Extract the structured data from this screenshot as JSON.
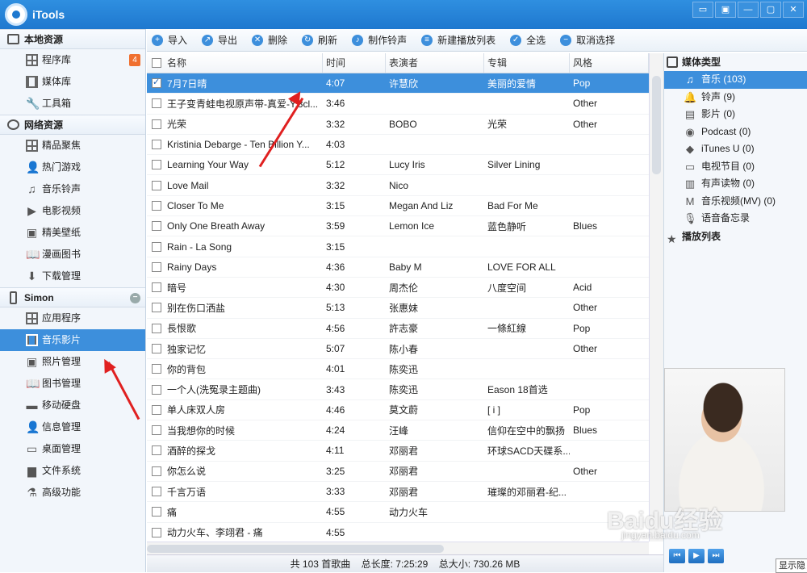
{
  "app": {
    "title": "iTools"
  },
  "window_buttons": [
    "▭",
    "▣",
    "—",
    "▢",
    "✕"
  ],
  "sidebar": {
    "sections": [
      {
        "title": "本地资源",
        "icon": "monitor-icon",
        "items": [
          {
            "label": "程序库",
            "icon": "grid-icon",
            "badge": "4"
          },
          {
            "label": "媒体库",
            "icon": "film-icon"
          },
          {
            "label": "工具箱",
            "icon": "wrench-icon"
          }
        ]
      },
      {
        "title": "网络资源",
        "icon": "globe-icon",
        "items": [
          {
            "label": "精品聚焦",
            "icon": "grid-icon"
          },
          {
            "label": "热门游戏",
            "icon": "person-icon"
          },
          {
            "label": "音乐铃声",
            "icon": "music-note-icon"
          },
          {
            "label": "电影视频",
            "icon": "video-icon"
          },
          {
            "label": "精美壁纸",
            "icon": "picture-icon"
          },
          {
            "label": "漫画图书",
            "icon": "book-icon"
          },
          {
            "label": "下载管理",
            "icon": "download-icon"
          }
        ]
      },
      {
        "title": "Simon",
        "icon": "phone-icon",
        "items": [
          {
            "label": "应用程序",
            "icon": "grid-icon"
          },
          {
            "label": "音乐影片",
            "icon": "film-icon",
            "active": true
          },
          {
            "label": "照片管理",
            "icon": "picture-icon"
          },
          {
            "label": "图书管理",
            "icon": "book-icon"
          },
          {
            "label": "移动硬盘",
            "icon": "usb-drive-icon"
          },
          {
            "label": "信息管理",
            "icon": "contact-icon"
          },
          {
            "label": "桌面管理",
            "icon": "desktop-icon"
          },
          {
            "label": "文件系统",
            "icon": "folder-icon"
          },
          {
            "label": "高级功能",
            "icon": "flask-icon"
          }
        ]
      }
    ]
  },
  "toolbar": [
    {
      "label": "导入",
      "icon": "import-icon",
      "glyph": "+"
    },
    {
      "label": "导出",
      "icon": "export-icon",
      "glyph": "↗"
    },
    {
      "label": "删除",
      "icon": "delete-icon",
      "glyph": "✕"
    },
    {
      "label": "刷新",
      "icon": "refresh-icon",
      "glyph": "↻"
    },
    {
      "label": "制作铃声",
      "icon": "bell-icon",
      "glyph": "♪"
    },
    {
      "label": "新建播放列表",
      "icon": "playlist-icon",
      "glyph": "≡"
    },
    {
      "label": "全选",
      "icon": "select-all-icon",
      "glyph": "✓"
    },
    {
      "label": "取消选择",
      "icon": "deselect-icon",
      "glyph": "−"
    }
  ],
  "table": {
    "columns": [
      "名称",
      "时间",
      "表演者",
      "专辑",
      "风格"
    ],
    "rows": [
      {
        "name": "7月7日晴",
        "time": "4:07",
        "artist": "许慧欣",
        "album": "美丽的爱情",
        "genre": "Pop",
        "selected": true
      },
      {
        "name": "王子变青蛙电视原声带-真爱-Y.3cl...",
        "time": "3:46",
        "artist": "",
        "album": "",
        "genre": "Other"
      },
      {
        "name": "光荣",
        "time": "3:32",
        "artist": "BOBO",
        "album": "光荣",
        "genre": "Other"
      },
      {
        "name": "Kristinia Debarge - Ten Billion Y...",
        "time": "4:03",
        "artist": "",
        "album": "",
        "genre": ""
      },
      {
        "name": "Learning Your Way",
        "time": "5:12",
        "artist": "Lucy Iris",
        "album": "Silver Lining",
        "genre": ""
      },
      {
        "name": "Love Mail",
        "time": "3:32",
        "artist": "Nico",
        "album": "",
        "genre": ""
      },
      {
        "name": "Closer To Me",
        "time": "3:15",
        "artist": "Megan And Liz",
        "album": "Bad For Me",
        "genre": ""
      },
      {
        "name": "Only One Breath Away",
        "time": "3:59",
        "artist": "Lemon Ice",
        "album": "蓝色静听",
        "genre": "Blues"
      },
      {
        "name": "Rain - La Song",
        "time": "3:15",
        "artist": "",
        "album": "",
        "genre": ""
      },
      {
        "name": "Rainy Days",
        "time": "4:36",
        "artist": "Baby M",
        "album": "LOVE FOR ALL",
        "genre": ""
      },
      {
        "name": "暗号",
        "time": "4:30",
        "artist": "周杰伦",
        "album": "八度空间",
        "genre": "Acid"
      },
      {
        "name": "别在伤口洒盐",
        "time": "5:13",
        "artist": "张惠妹",
        "album": "",
        "genre": "Other"
      },
      {
        "name": "長恨歌",
        "time": "4:56",
        "artist": "許志豪",
        "album": "一條紅線",
        "genre": "Pop"
      },
      {
        "name": "独家记忆",
        "time": "5:07",
        "artist": "陈小春",
        "album": "",
        "genre": "Other"
      },
      {
        "name": "你的背包",
        "time": "4:01",
        "artist": "陈奕迅",
        "album": "",
        "genre": ""
      },
      {
        "name": "一个人(洗冤录主题曲)",
        "time": "3:43",
        "artist": "陈奕迅",
        "album": "Eason 18首选",
        "genre": ""
      },
      {
        "name": "单人床双人房",
        "time": "4:46",
        "artist": "莫文蔚",
        "album": "[ i ]",
        "genre": "Pop"
      },
      {
        "name": "当我想你的时候",
        "time": "4:24",
        "artist": "汪峰",
        "album": "信仰在空中的飘扬",
        "genre": "Blues"
      },
      {
        "name": "酒醉的探戈",
        "time": "4:11",
        "artist": "邓丽君",
        "album": "环球SACD天碟系...",
        "genre": ""
      },
      {
        "name": "你怎么说",
        "time": "3:25",
        "artist": "邓丽君",
        "album": "",
        "genre": "Other"
      },
      {
        "name": "千言万语",
        "time": "3:33",
        "artist": "邓丽君",
        "album": "璀璨的邓丽君-纪...",
        "genre": ""
      },
      {
        "name": "痛",
        "time": "4:55",
        "artist": "动力火车",
        "album": "",
        "genre": ""
      },
      {
        "name": "动力火车、李翊君 - 痛",
        "time": "4:55",
        "artist": "",
        "album": "",
        "genre": ""
      }
    ]
  },
  "status": {
    "count": "共 103 首歌曲",
    "length": "总长度: 7:25:29",
    "size": "总大小: 730.26 MB"
  },
  "media_panel": {
    "header": "媒体类型",
    "items": [
      {
        "label": "音乐 (103)",
        "icon": "music-note-icon",
        "glyph": "♫",
        "active": true
      },
      {
        "label": "铃声 (9)",
        "icon": "bell-icon",
        "glyph": "🔔"
      },
      {
        "label": "影片 (0)",
        "icon": "film-icon",
        "glyph": "▤"
      },
      {
        "label": "Podcast (0)",
        "icon": "podcast-icon",
        "glyph": "◉"
      },
      {
        "label": "iTunes U (0)",
        "icon": "graduation-cap-icon",
        "glyph": "◆"
      },
      {
        "label": "电视节目 (0)",
        "icon": "tv-icon",
        "glyph": "▭"
      },
      {
        "label": "有声读物 (0)",
        "icon": "audiobook-icon",
        "glyph": "▥"
      },
      {
        "label": "音乐视频(MV) (0)",
        "icon": "music-video-icon",
        "glyph": "M"
      },
      {
        "label": "语音备忘录",
        "icon": "microphone-icon",
        "glyph": "🎙"
      }
    ],
    "playlist_label": "播放列表"
  },
  "player": {
    "buttons": [
      "⏮",
      "▶",
      "⏭"
    ],
    "show_button": "显示隐"
  },
  "watermark": {
    "text": "Baidu经验",
    "url": "jingyan.baidu.com"
  }
}
